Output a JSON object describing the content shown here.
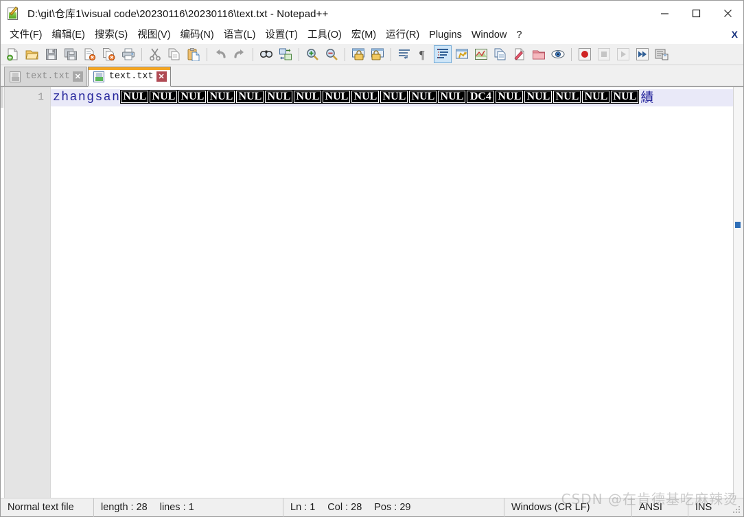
{
  "window": {
    "title": "D:\\git\\仓库1\\visual code\\20230116\\20230116\\text.txt - Notepad++",
    "icon": "notepad-plus-plus-icon",
    "controls": {
      "minimize": "—",
      "maximize": "□",
      "close": "✕"
    }
  },
  "menubar": {
    "items": [
      {
        "label": "文件(F)",
        "name": "menu-file"
      },
      {
        "label": "编辑(E)",
        "name": "menu-edit"
      },
      {
        "label": "搜索(S)",
        "name": "menu-search"
      },
      {
        "label": "视图(V)",
        "name": "menu-view"
      },
      {
        "label": "编码(N)",
        "name": "menu-encoding"
      },
      {
        "label": "语言(L)",
        "name": "menu-language"
      },
      {
        "label": "设置(T)",
        "name": "menu-settings"
      },
      {
        "label": "工具(O)",
        "name": "menu-tools"
      },
      {
        "label": "宏(M)",
        "name": "menu-macro"
      },
      {
        "label": "运行(R)",
        "name": "menu-run"
      },
      {
        "label": "Plugins",
        "name": "menu-plugins"
      },
      {
        "label": "Window",
        "name": "menu-window"
      },
      {
        "label": "?",
        "name": "menu-help"
      }
    ],
    "close_document": "X"
  },
  "toolbar": {
    "groups": [
      [
        "new-file-icon",
        "open-file-icon",
        "save-icon",
        "save-all-icon",
        "close-file-icon",
        "close-all-files-icon",
        "print-icon"
      ],
      [
        "cut-icon",
        "copy-icon",
        "paste-icon"
      ],
      [
        "undo-icon",
        "redo-icon"
      ],
      [
        "find-icon",
        "replace-icon"
      ],
      [
        "zoom-in-icon",
        "zoom-out-icon"
      ],
      [
        "sync-vertical-scroll-icon",
        "sync-horizontal-scroll-icon"
      ],
      [
        "word-wrap-icon",
        "show-all-characters-icon",
        "indent-guide-icon",
        "user-defined-language-icon",
        "document-map-icon",
        "function-list-icon",
        "document-switcher-icon",
        "folder-as-workspace-icon",
        "monitoring-icon"
      ],
      [
        "start-recording-macro-icon",
        "stop-recording-macro-icon",
        "play-macro-icon",
        "run-macro-multiple-times-icon",
        "save-current-macro-icon"
      ]
    ],
    "active_tool": "indent-guide-icon"
  },
  "tabs": [
    {
      "label": "text.txt",
      "active": false,
      "close": "✕",
      "icon": "saved-file-icon"
    },
    {
      "label": "text.txt",
      "active": true,
      "close": "✕",
      "icon": "saved-file-icon"
    }
  ],
  "editor": {
    "line_numbers": [
      "1"
    ],
    "line1": {
      "text_prefix": "zhangsan",
      "control_chars": [
        "NUL",
        "NUL",
        "NUL",
        "NUL",
        "NUL",
        "NUL",
        "NUL",
        "NUL",
        "NUL",
        "NUL",
        "NUL",
        "NUL",
        "DC4",
        "NUL",
        "NUL",
        "NUL",
        "NUL",
        "NUL"
      ],
      "text_suffix": "績"
    }
  },
  "statusbar": {
    "file_type": "Normal text file",
    "length_label": "length : 28",
    "lines_label": "lines : 1",
    "ln": "Ln : 1",
    "col": "Col : 28",
    "pos": "Pos : 29",
    "eol": "Windows (CR LF)",
    "encoding": "ANSI",
    "insert_mode": "INS"
  },
  "watermark": "CSDN @在肯德基吃麻辣烫",
  "colors": {
    "tab_active_accent": "#f5a623",
    "current_line_bg": "#e9e9f8",
    "code_text": "#24249b",
    "gutter_bg": "#e4e4e4",
    "toolbar_bg": "#f0f0f0",
    "tab_close_active": "#b04a54"
  }
}
